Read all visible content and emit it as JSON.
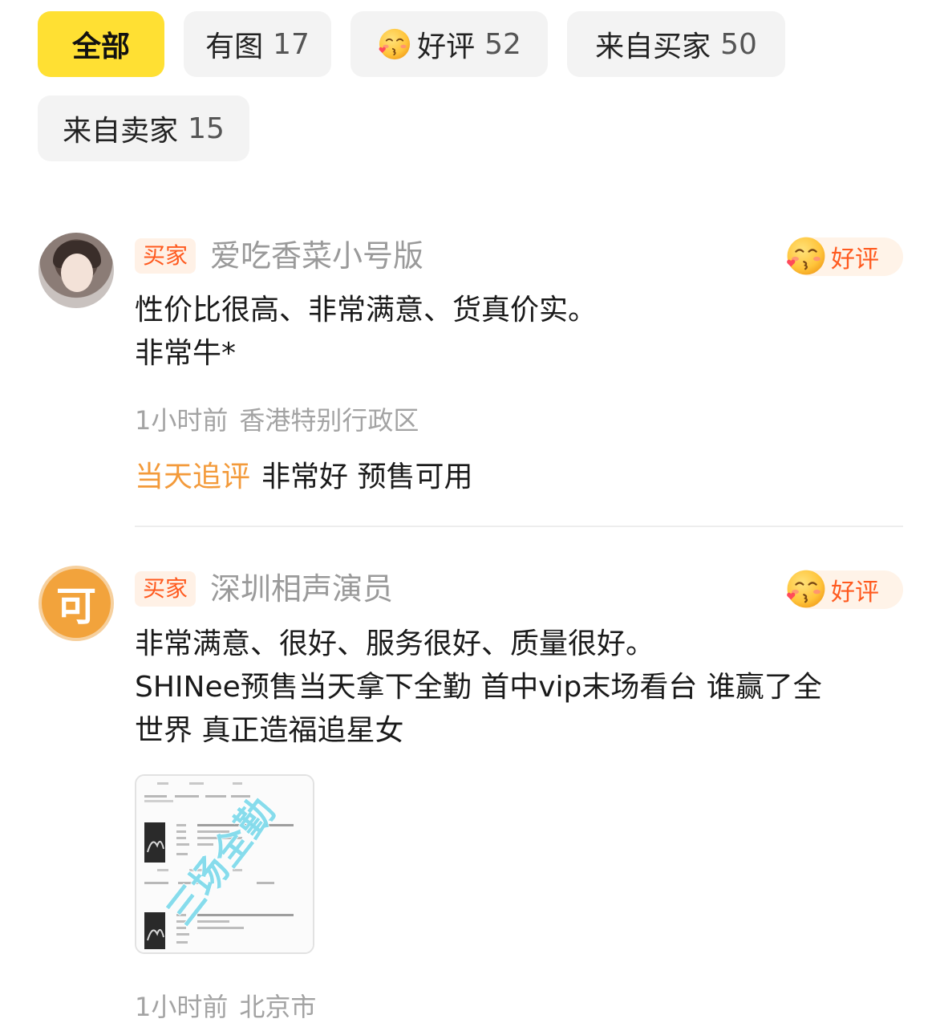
{
  "filters": [
    {
      "label": "全部",
      "count": "",
      "active": true
    },
    {
      "label": "有图",
      "count": "17",
      "active": false
    },
    {
      "label": "好评",
      "count": "52",
      "active": false,
      "icon": "kiss-emoji-icon"
    },
    {
      "label": "来自买家",
      "count": "50",
      "active": false
    },
    {
      "label": "来自卖家",
      "count": "15",
      "active": false
    }
  ],
  "reviews": [
    {
      "role_tag": "买家",
      "username": "爱吃香菜小号版",
      "rating_label": "好评",
      "avatar": "photo",
      "text_lines": [
        "性价比很高、非常满意、货真价实。",
        "非常牛*"
      ],
      "time": "1小时前",
      "location": "香港特别行政区",
      "followup_label": "当天追评",
      "followup_text": "非常好 预售可用"
    },
    {
      "role_tag": "买家",
      "username": "深圳相声演员",
      "rating_label": "好评",
      "avatar": "letter",
      "avatar_letter": "可",
      "text_lines": [
        "非常满意、很好、服务很好、质量很好。",
        "SHINee预售当天拿下全勤 首中vip末场看台 谁赢了全",
        "世界 真正造福追星女"
      ],
      "image": {
        "watermark": "三场全勤"
      },
      "time": "1小时前",
      "location": "北京市"
    }
  ],
  "colors": {
    "active_chip": "#ffe033",
    "chip_bg": "#f3f3f3",
    "buyer_tag_text": "#ff5a1f",
    "followup_label": "#f39a3a",
    "watermark": "#5fd0e6"
  }
}
